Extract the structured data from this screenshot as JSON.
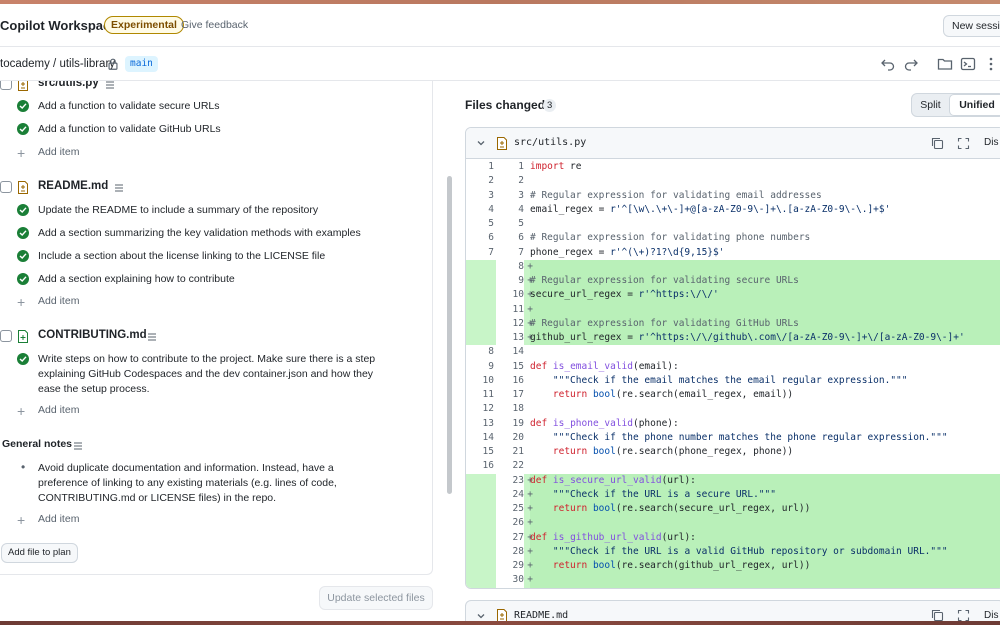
{
  "header": {
    "brand": "Copilot Workspace",
    "badge": "Experimental",
    "feedback": "Give feedback",
    "new_session": "New session"
  },
  "repo": {
    "path": "tocademy / utils-library",
    "branch": "main"
  },
  "plan": {
    "files": [
      {
        "name": "src/utils.py",
        "items": [
          "Add a function to validate secure URLs",
          "Add a function to validate GitHub URLs"
        ],
        "add_item": "Add item"
      },
      {
        "name": "README.md",
        "items": [
          "Update the README to include a summary of the repository",
          "Add a section summarizing the key validation methods with examples",
          "Include a section about the license linking to the LICENSE file",
          "Add a section explaining how to contribute"
        ],
        "add_item": "Add item"
      },
      {
        "name": "CONTRIBUTING.md",
        "items": [
          "Write steps on how to contribute to the project. Make sure there is a step explaining GitHub Codespaces and the dev container.json and how they ease the setup process."
        ],
        "add_item": "Add item"
      }
    ],
    "general_notes": {
      "title": "General notes",
      "items": [
        "Avoid duplicate documentation and information. Instead, have a preference of linking to any existing materials (e.g. lines of code, CONTRIBUTING.md or LICENSE files) in the repo."
      ],
      "add_item": "Add item"
    },
    "add_file_button": "Add file to plan",
    "update_button": "Update selected files"
  },
  "files_changed": {
    "title": "Files changed",
    "count": "3",
    "split_label": "Split",
    "unified_label": "Unified",
    "diffs": [
      {
        "path": "src/utils.py",
        "dismiss": "Dis",
        "lines": [
          {
            "old": "1",
            "new": "1",
            "type": "ctx",
            "code": "import re"
          },
          {
            "old": "2",
            "new": "2",
            "type": "ctx",
            "code": ""
          },
          {
            "old": "3",
            "new": "3",
            "type": "ctx",
            "code": "# Regular expression for validating email addresses"
          },
          {
            "old": "4",
            "new": "4",
            "type": "ctx",
            "code": "email_regex = r'^[\\w\\.\\+\\-]+@[a-zA-Z0-9\\-]+\\.[a-zA-Z0-9\\-\\.]+$'"
          },
          {
            "old": "5",
            "new": "5",
            "type": "ctx",
            "code": ""
          },
          {
            "old": "6",
            "new": "6",
            "type": "ctx",
            "code": "# Regular expression for validating phone numbers"
          },
          {
            "old": "7",
            "new": "7",
            "type": "ctx",
            "code": "phone_regex = r'^(\\+)?1?\\d{9,15}$'"
          },
          {
            "old": "",
            "new": "8",
            "type": "add",
            "code": ""
          },
          {
            "old": "",
            "new": "9",
            "type": "add",
            "code": "# Regular expression for validating secure URLs"
          },
          {
            "old": "",
            "new": "10",
            "type": "add",
            "code": "secure_url_regex = r'^https:\\/\\/'"
          },
          {
            "old": "",
            "new": "11",
            "type": "add",
            "code": ""
          },
          {
            "old": "",
            "new": "12",
            "type": "add",
            "code": "# Regular expression for validating GitHub URLs"
          },
          {
            "old": "",
            "new": "13",
            "type": "add",
            "code": "github_url_regex = r'^https:\\/\\/github\\.com\\/[a-zA-Z0-9\\-]+\\/[a-zA-Z0-9\\-]+'"
          },
          {
            "old": "8",
            "new": "14",
            "type": "ctx",
            "code": ""
          },
          {
            "old": "9",
            "new": "15",
            "type": "ctx",
            "code": "def is_email_valid(email):"
          },
          {
            "old": "10",
            "new": "16",
            "type": "ctx",
            "code": "    \"\"\"Check if the email matches the email regular expression.\"\"\""
          },
          {
            "old": "11",
            "new": "17",
            "type": "ctx",
            "code": "    return bool(re.search(email_regex, email))"
          },
          {
            "old": "12",
            "new": "18",
            "type": "ctx",
            "code": ""
          },
          {
            "old": "13",
            "new": "19",
            "type": "ctx",
            "code": "def is_phone_valid(phone):"
          },
          {
            "old": "14",
            "new": "20",
            "type": "ctx",
            "code": "    \"\"\"Check if the phone number matches the phone regular expression.\"\"\""
          },
          {
            "old": "15",
            "new": "21",
            "type": "ctx",
            "code": "    return bool(re.search(phone_regex, phone))"
          },
          {
            "old": "16",
            "new": "22",
            "type": "ctx",
            "code": ""
          },
          {
            "old": "",
            "new": "23",
            "type": "add",
            "code": "def is_secure_url_valid(url):"
          },
          {
            "old": "",
            "new": "24",
            "type": "add",
            "code": "    \"\"\"Check if the URL is a secure URL.\"\"\""
          },
          {
            "old": "",
            "new": "25",
            "type": "add",
            "code": "    return bool(re.search(secure_url_regex, url))"
          },
          {
            "old": "",
            "new": "26",
            "type": "add",
            "code": ""
          },
          {
            "old": "",
            "new": "27",
            "type": "add",
            "code": "def is_github_url_valid(url):"
          },
          {
            "old": "",
            "new": "28",
            "type": "add",
            "code": "    \"\"\"Check if the URL is a valid GitHub repository or subdomain URL.\"\"\""
          },
          {
            "old": "",
            "new": "29",
            "type": "add",
            "code": "    return bool(re.search(github_url_regex, url))"
          },
          {
            "old": "",
            "new": "30",
            "type": "add",
            "code": ""
          }
        ]
      },
      {
        "path": "README.md",
        "dismiss": "Dis"
      }
    ]
  },
  "colors": {
    "accent_green": "#1a7f37",
    "added_line_bg": "#b9f0b9",
    "badge_border": "#b08800",
    "branch_text": "#0969da"
  }
}
